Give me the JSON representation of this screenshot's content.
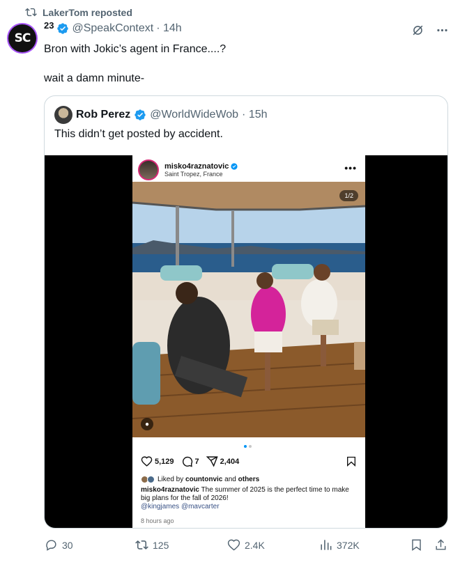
{
  "repost": {
    "text": "LakerTom reposted"
  },
  "tweet": {
    "display_name": "23",
    "handle": "@SpeakContext",
    "time": "· 14h",
    "lines": [
      "Bron with Jokic’s agent in France....?",
      "wait a damn minute-"
    ],
    "avatar_text": "SC"
  },
  "quote": {
    "display_name": "Rob Perez",
    "handle": "@WorldWideWob",
    "time": "· 15h",
    "text": "This didn’t get posted by accident."
  },
  "instagram": {
    "username": "misko4raznatovic",
    "location": "Saint Tropez, France",
    "counter": "1/2",
    "likes": "5,129",
    "comments": "7",
    "shares": "2,404",
    "liked_by_prefix": "Liked by ",
    "liked_by_user": "countonvic",
    "liked_by_and": " and ",
    "liked_by_others": "others",
    "caption_user": "misko4raznatovic",
    "caption_text": " The summer of 2025 is the perfect time to make big plans for the fall of 2026!",
    "mentions": "@kingjames @mavcarter",
    "ago": "8 hours ago"
  },
  "footer": {
    "replies": "30",
    "reposts": "125",
    "likes": "2.4K",
    "views": "372K"
  },
  "colors": {
    "accent": "#1d9bf0",
    "muted": "#536471",
    "repost_green": "#00ba7c"
  }
}
